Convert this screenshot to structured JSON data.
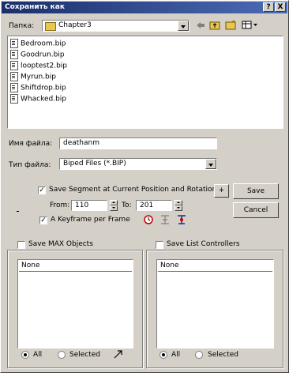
{
  "window": {
    "title": "Сохранить как",
    "help_btn": "?",
    "close_btn": "X"
  },
  "folder": {
    "label": "Папка:",
    "value": "Chapter3"
  },
  "files": [
    "Bedroom.bip",
    "Goodrun.bip",
    "looptest2.bip",
    "Myrun.bip",
    "Shiftdrop.bip",
    "Whacked.bip"
  ],
  "filename": {
    "label": "Имя файла:",
    "value": "deathanm"
  },
  "filetype": {
    "label": "Тип файла:",
    "value": "Biped Files (*.BIP)"
  },
  "options": {
    "save_segment": "Save Segment at Current Position and Rotation",
    "from_label": "From:",
    "from_value": "110",
    "to_label": "To:",
    "to_value": "201",
    "keyframe": "A Keyframe per Frame",
    "plus": "+"
  },
  "buttons": {
    "save": "Save",
    "cancel": "Cancel"
  },
  "max_objects": {
    "label": "Save MAX Objects",
    "list_header": "None",
    "all": "All",
    "selected": "Selected"
  },
  "list_controllers": {
    "label": "Save List Controllers",
    "list_header": "None",
    "all": "All",
    "selected": "Selected"
  }
}
